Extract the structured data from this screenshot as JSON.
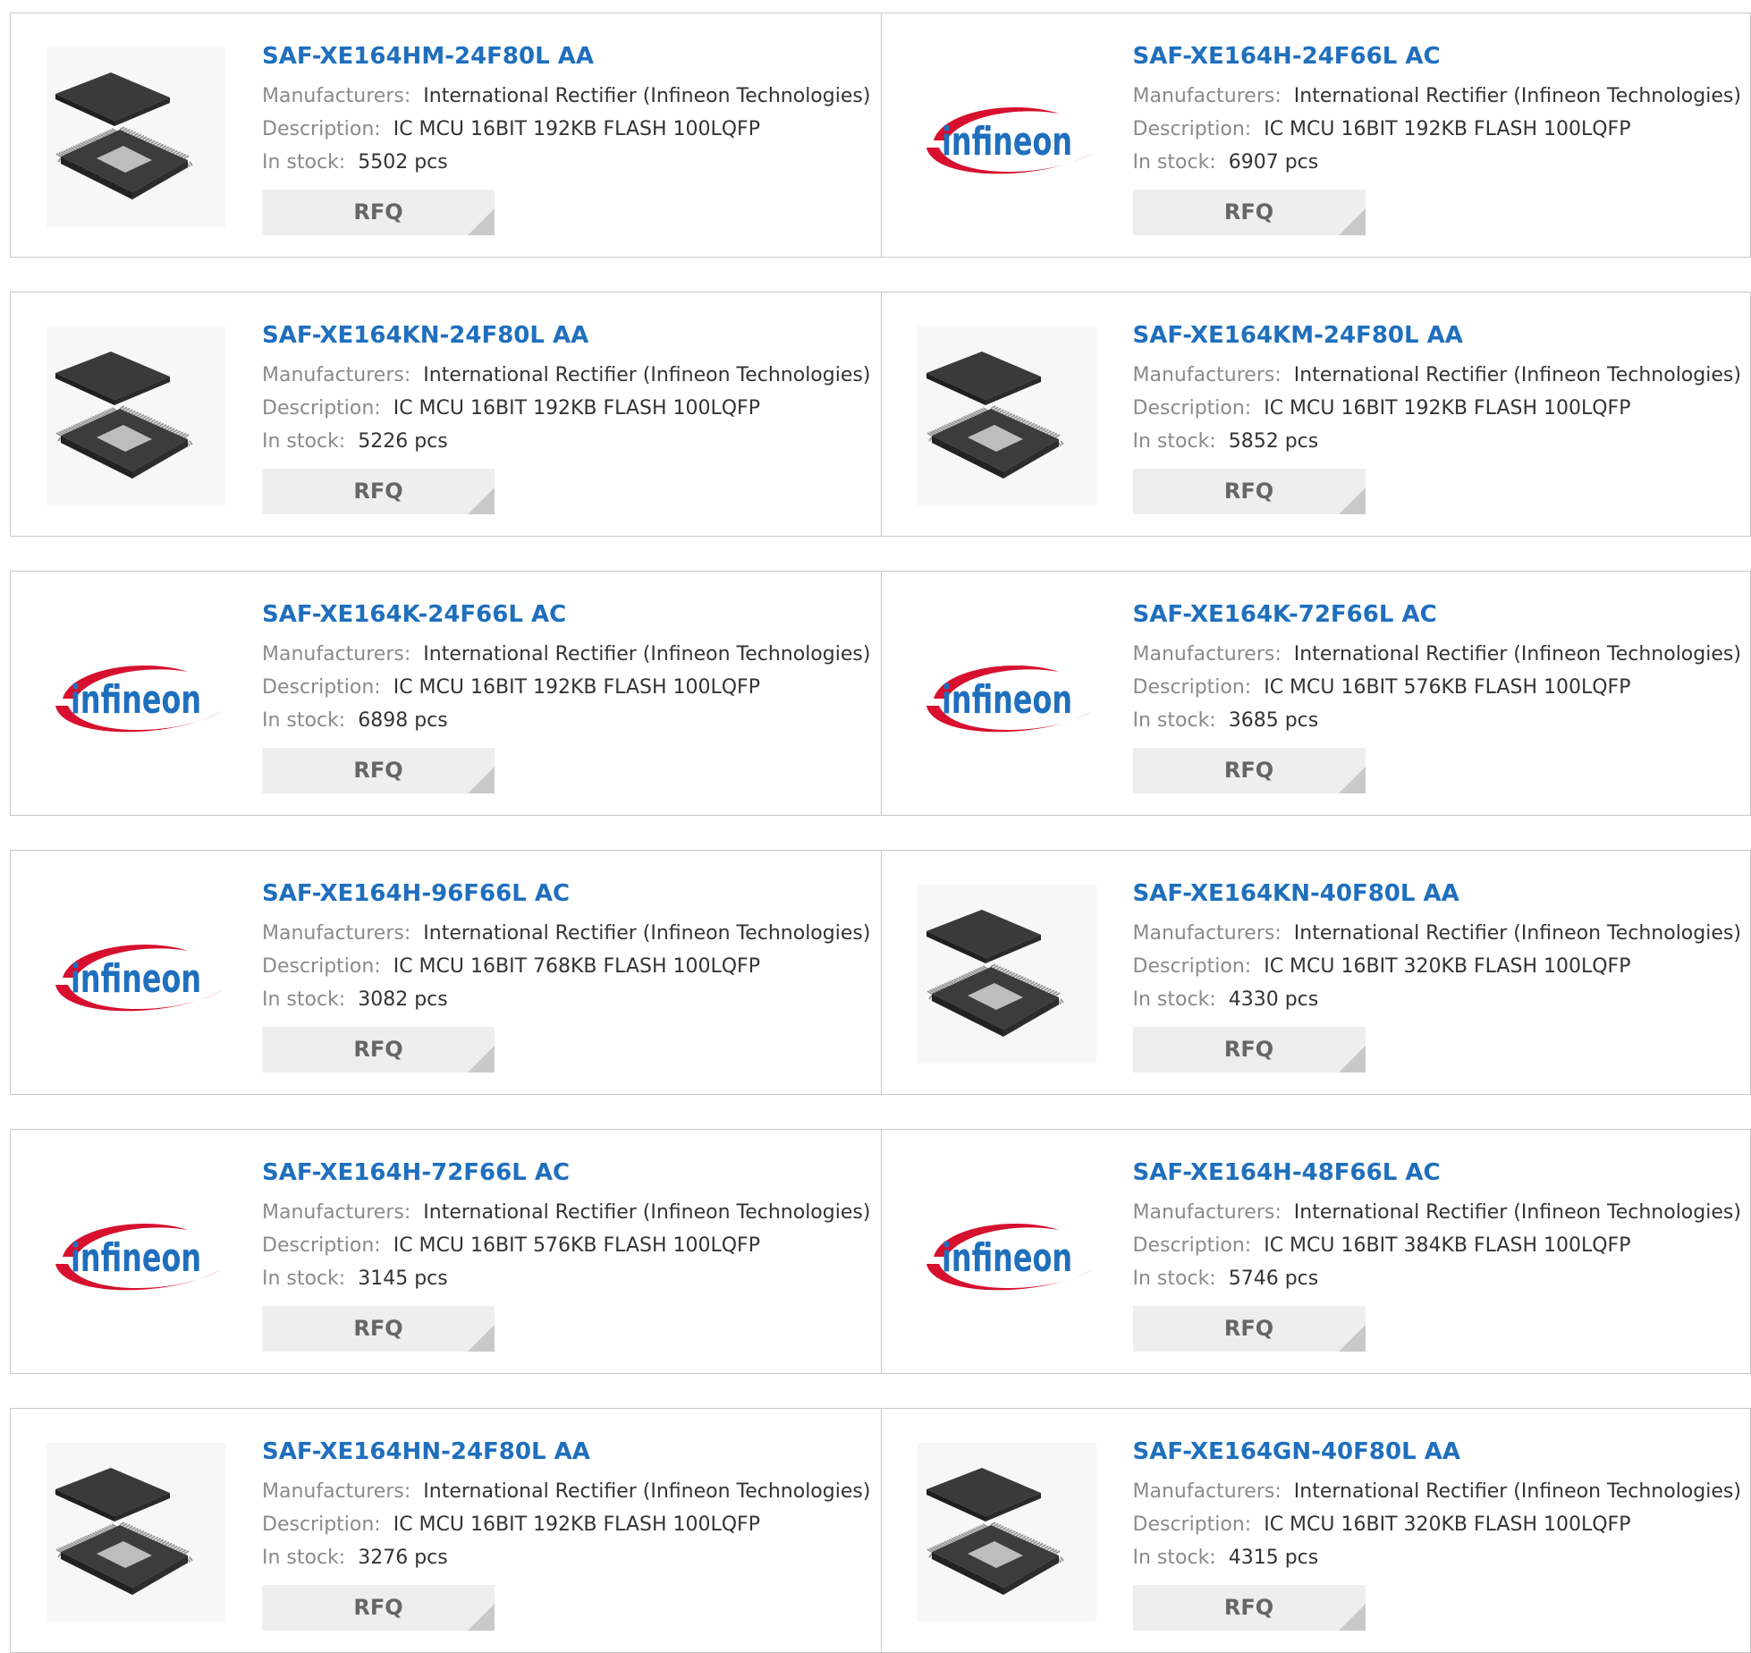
{
  "labels": {
    "manufacturers": "Manufacturers:",
    "description": "Description:",
    "stock": "In stock:",
    "rfq": "RFQ"
  },
  "colors": {
    "title_link": "#1f6fbd",
    "label": "#8a8a8a",
    "value": "#333333",
    "infineon_logo_text": "#1f6fbd",
    "infineon_logo_swoosh": "#d6102e"
  },
  "products": [
    {
      "part": "SAF-XE164HM-24F80L AA",
      "manufacturer": "International Rectifier (Infineon Technologies)",
      "description": "IC MCU 16BIT 192KB FLASH 100LQFP",
      "stock": "5502 pcs",
      "image": "chip-image",
      "logo_text": ""
    },
    {
      "part": "SAF-XE164H-24F66L AC",
      "manufacturer": "International Rectifier (Infineon Technologies)",
      "description": "IC MCU 16BIT 192KB FLASH 100LQFP",
      "stock": "6907 pcs",
      "image": "infineon-logo",
      "logo_text": "infineon"
    },
    {
      "part": "SAF-XE164KN-24F80L AA",
      "manufacturer": "International Rectifier (Infineon Technologies)",
      "description": "IC MCU 16BIT 192KB FLASH 100LQFP",
      "stock": "5226 pcs",
      "image": "chip-image",
      "logo_text": ""
    },
    {
      "part": "SAF-XE164KM-24F80L AA",
      "manufacturer": "International Rectifier (Infineon Technologies)",
      "description": "IC MCU 16BIT 192KB FLASH 100LQFP",
      "stock": "5852 pcs",
      "image": "chip-image",
      "logo_text": ""
    },
    {
      "part": "SAF-XE164K-24F66L AC",
      "manufacturer": "International Rectifier (Infineon Technologies)",
      "description": "IC MCU 16BIT 192KB FLASH 100LQFP",
      "stock": "6898 pcs",
      "image": "infineon-logo",
      "logo_text": "infineon"
    },
    {
      "part": "SAF-XE164K-72F66L AC",
      "manufacturer": "International Rectifier (Infineon Technologies)",
      "description": "IC MCU 16BIT 576KB FLASH 100LQFP",
      "stock": "3685 pcs",
      "image": "infineon-logo",
      "logo_text": "infineon"
    },
    {
      "part": "SAF-XE164H-96F66L AC",
      "manufacturer": "International Rectifier (Infineon Technologies)",
      "description": "IC MCU 16BIT 768KB FLASH 100LQFP",
      "stock": "3082 pcs",
      "image": "infineon-logo",
      "logo_text": "infineon"
    },
    {
      "part": "SAF-XE164KN-40F80L AA",
      "manufacturer": "International Rectifier (Infineon Technologies)",
      "description": "IC MCU 16BIT 320KB FLASH 100LQFP",
      "stock": "4330 pcs",
      "image": "chip-image",
      "logo_text": ""
    },
    {
      "part": "SAF-XE164H-72F66L AC",
      "manufacturer": "International Rectifier (Infineon Technologies)",
      "description": "IC MCU 16BIT 576KB FLASH 100LQFP",
      "stock": "3145 pcs",
      "image": "infineon-logo",
      "logo_text": "infineon"
    },
    {
      "part": "SAF-XE164H-48F66L AC",
      "manufacturer": "International Rectifier (Infineon Technologies)",
      "description": "IC MCU 16BIT 384KB FLASH 100LQFP",
      "stock": "5746 pcs",
      "image": "infineon-logo",
      "logo_text": "infineon"
    },
    {
      "part": "SAF-XE164HN-24F80L AA",
      "manufacturer": "International Rectifier (Infineon Technologies)",
      "description": "IC MCU 16BIT 192KB FLASH 100LQFP",
      "stock": "3276 pcs",
      "image": "chip-image",
      "logo_text": ""
    },
    {
      "part": "SAF-XE164GN-40F80L AA",
      "manufacturer": "International Rectifier (Infineon Technologies)",
      "description": "IC MCU 16BIT 320KB FLASH 100LQFP",
      "stock": "4315 pcs",
      "image": "chip-image",
      "logo_text": ""
    }
  ]
}
